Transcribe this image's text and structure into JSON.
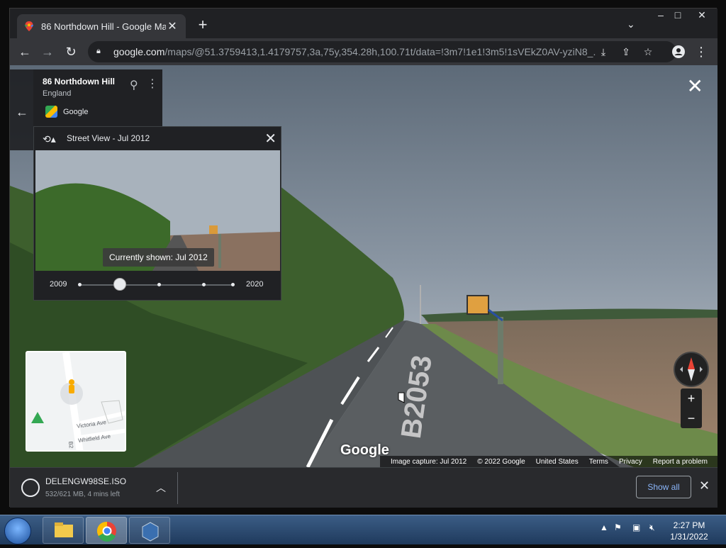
{
  "browser": {
    "tab_title": "86 Northdown Hill - Google Maps",
    "tab_close": "✕",
    "new_tab": "+",
    "url_host": "google.com",
    "url_path": "/maps/@51.3759413,1.4179757,3a,75y,354.28h,100.71t/data=!3m7!1e1!3m5!1sVEkZ0AV-yziN8_...",
    "window_controls": [
      "–",
      "□",
      "✕"
    ]
  },
  "streetview": {
    "close": "✕",
    "road_marking": "B2053",
    "logo": "Google",
    "place": {
      "title": "86 Northdown Hill",
      "region": "England",
      "source": "Google"
    },
    "timetravel": {
      "title": "Street View - Jul 2012",
      "tooltip": "Currently shown: Jul 2012",
      "start_year": "2009",
      "end_year": "2020",
      "selected_index": 1,
      "stops": 5
    },
    "minimap": {
      "street1": "Victoria Ave",
      "street2": "Whitfield Ave",
      "road_label": "B2"
    },
    "footer": {
      "capture": "Image capture: Jul 2012",
      "copyright": "© 2022 Google",
      "country": "United States",
      "terms": "Terms",
      "privacy": "Privacy",
      "report": "Report a problem"
    },
    "zoom_in": "+",
    "zoom_out": "−"
  },
  "downloads": {
    "file_name": "DELENGW98SE.ISO",
    "status": "532/621 MB, 4 mins left",
    "show_all": "Show all",
    "close": "✕"
  },
  "taskbar": {
    "time": "2:27 PM",
    "date": "1/31/2022"
  },
  "colors": {
    "chrome_dark": "#202124",
    "toolbar": "#35363a",
    "link_blue": "#8ab4f8"
  }
}
